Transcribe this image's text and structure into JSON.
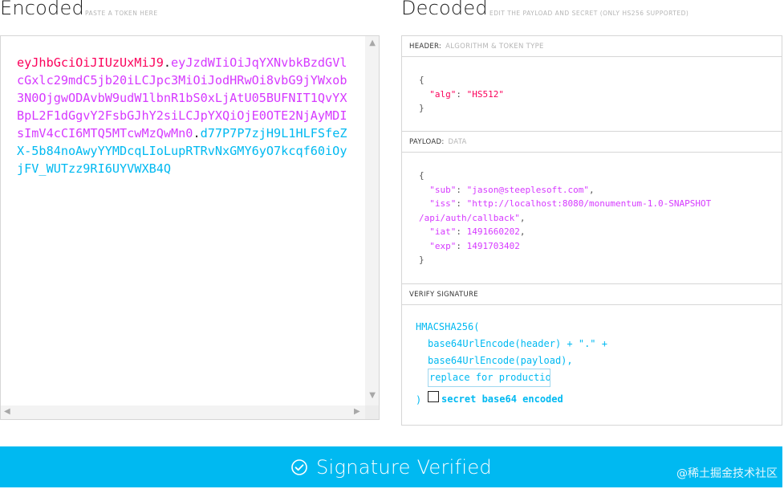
{
  "encoded": {
    "title": "Encoded",
    "hint": "PASTE A TOKEN HERE",
    "token_header": "eyJhbGciOiJIUzUxMiJ9",
    "token_payload": "eyJzdWIiOiJqYXNvbkBzdGVlcGxlc29mdC5jb20iLCJpc3MiOiJodHRwOi8vbG9jYWxob3N0OjgwODAvbW9udW1lbnR1bS0xLjAtU05BUFNIT1QvYXBpL2F1dGgvY2FsbGJhY2siLCJpYXQiOjE0OTE2NjAyMDIsImV4cCI6MTQ5MTcwMzQwMn0",
    "token_signature": "d77P7P7zjH9L1HLFSfeZX-5b84noAwyYYMDcqLIoLupRTRvNxGMY6yO7kcqf60iOyjFV_WUTzz9RI6UYVWXB4Q",
    "dot": "."
  },
  "decoded": {
    "title": "Decoded",
    "hint": "EDIT THE PAYLOAD AND SECRET (ONLY HS256 SUPPORTED)",
    "header_section": {
      "label": "HEADER:",
      "sublabel": "ALGORITHM & TOKEN TYPE",
      "key": "\"alg\"",
      "value": "\"HS512\""
    },
    "payload_section": {
      "label": "PAYLOAD:",
      "sublabel": "DATA",
      "sub_key": "\"sub\"",
      "sub_value": "\"jason@steeplesoft.com\"",
      "iss_key": "\"iss\"",
      "iss_value_1": "\"http://localhost:8080/monumentum-1.0-SNAPSHOT",
      "iss_value_2": "/api/auth/callback\"",
      "iat_key": "\"iat\"",
      "iat_value": "1491660202",
      "exp_key": "\"exp\"",
      "exp_value": "1491703402"
    },
    "signature_section": {
      "label": "VERIFY SIGNATURE",
      "line1": "HMACSHA256(",
      "line2": "base64UrlEncode(header) + \".\" +",
      "line3": "base64UrlEncode(payload),",
      "secret_value": "replace for production",
      "close": ")",
      "checkbox_label": "secret base64 encoded"
    }
  },
  "status": {
    "label": "Signature Verified",
    "color": "#00b9f1"
  },
  "watermark": "@稀土掘金技术社区",
  "colors": {
    "header": "#fb015b",
    "payload": "#d63aff",
    "signature": "#00b9f1"
  }
}
